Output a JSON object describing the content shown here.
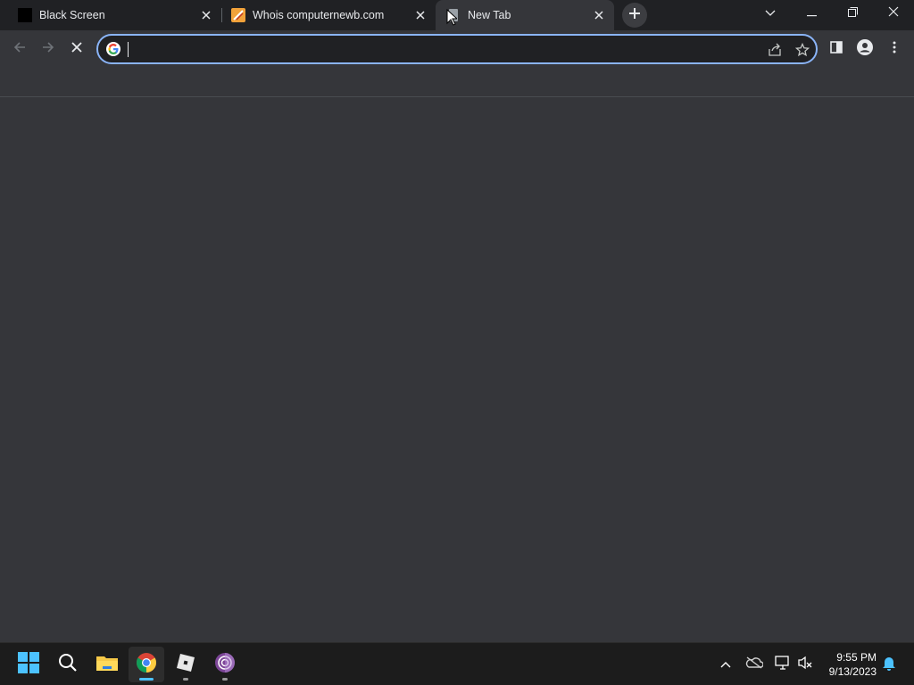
{
  "browser": {
    "tabs": [
      {
        "title": "Black Screen",
        "favicon": "black-square-icon",
        "active": false
      },
      {
        "title": "Whois computernewb.com",
        "favicon": "whois-site-icon",
        "active": false
      },
      {
        "title": "New Tab",
        "favicon": "loading-page-icon",
        "active": true
      }
    ],
    "new_tab_icon": "plus-icon",
    "window_controls": [
      "tab-search-icon",
      "minimize-icon",
      "restore-icon",
      "close-icon"
    ]
  },
  "toolbar": {
    "omnibox": {
      "value": "",
      "placeholder": ""
    },
    "icons": [
      "back-arrow-icon",
      "forward-arrow-icon",
      "stop-loading-icon",
      "google-g-icon",
      "share-icon",
      "star-icon",
      "side-panel-icon",
      "profile-icon",
      "more-menu-icon"
    ]
  },
  "colors": {
    "tabstrip_bg": "#202124",
    "toolbar_bg": "#35363a",
    "omnibox_border": "#8ab4f8",
    "taskbar_bg": "#1c1c1c",
    "accent": "#8ab4f8"
  },
  "taskbar": {
    "apps": [
      "windows-start-icon",
      "search-icon",
      "file-explorer-icon",
      "chrome-icon",
      "roblox-icon",
      "tor-browser-icon"
    ],
    "active_app": "chrome-icon",
    "tray": [
      "chevron-up-icon",
      "onedrive-icon",
      "network-icon",
      "volume-muted-icon",
      "notification-bell-icon"
    ],
    "clock": {
      "time": "9:55 PM",
      "date": "9/13/2023"
    }
  }
}
